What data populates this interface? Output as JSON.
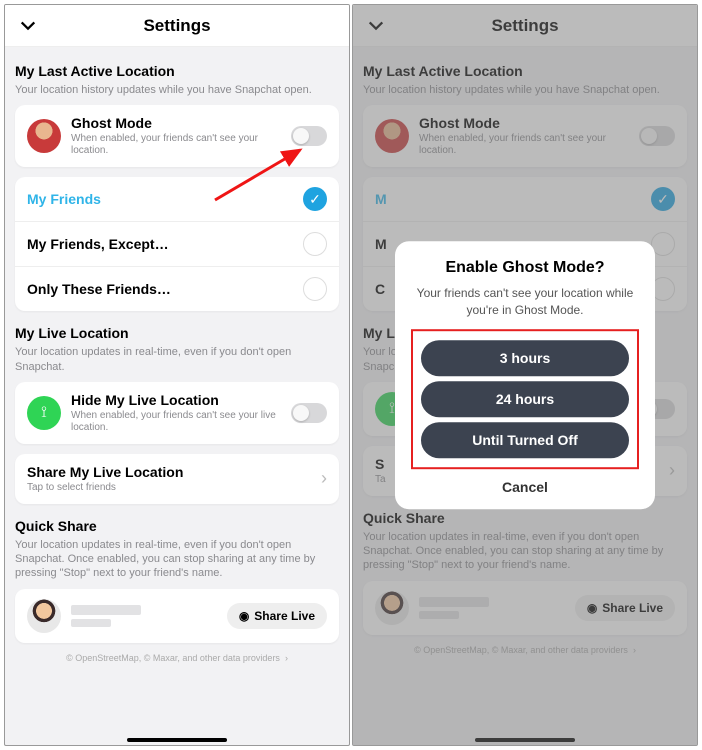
{
  "header": {
    "title": "Settings"
  },
  "sections": {
    "lastActive": {
      "title": "My Last Active Location",
      "sub": "Your location history updates while you have Snapchat open.",
      "ghost": {
        "title": "Ghost Mode",
        "sub": "When enabled, your friends can't see your location."
      },
      "opts": {
        "friends": "My Friends",
        "except": "My Friends, Except…",
        "only": "Only These Friends…"
      }
    },
    "live": {
      "title": "My Live Location",
      "sub": "Your location updates in real-time, even if you don't open Snapchat.",
      "hide": {
        "title": "Hide My Live Location",
        "sub": "When enabled, your friends can't see your live location."
      },
      "share": {
        "title": "Share My Live Location",
        "sub": "Tap to select friends"
      }
    },
    "quick": {
      "title": "Quick Share",
      "sub": "Your location updates in real-time, even if you don't open Snapchat. Once enabled, you can stop sharing at any time by pressing \"Stop\" next to your friend's name.",
      "btn": "Share Live"
    }
  },
  "footer": "© OpenStreetMap, © Maxar, and other data providers",
  "modal": {
    "title": "Enable Ghost Mode?",
    "body": "Your friends can't see your location while you're in Ghost Mode.",
    "b1": "3 hours",
    "b2": "24 hours",
    "b3": "Until Turned Off",
    "cancel": "Cancel"
  }
}
